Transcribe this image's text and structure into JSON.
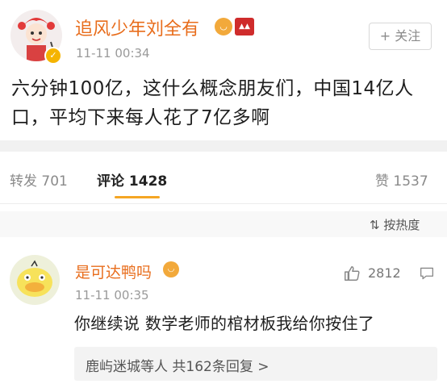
{
  "post": {
    "username": "追风少年刘全有",
    "time": "11-11 00:34",
    "follow_label": "+ 关注",
    "content": "六分钟100亿，这什么概念朋友们，中国14亿人口，平均下来每人花了7亿多啊",
    "icons": [
      "avatar-icon",
      "verified-icon",
      "emoji-badge-icon",
      "cat-badge-icon"
    ]
  },
  "tabs": {
    "repost": "转发 701",
    "comment": "评论 1428",
    "like": "赞 1537"
  },
  "sort_label": "按热度",
  "comment": {
    "username": "是可达鸭吗",
    "time": "11-11 00:35",
    "like_count": "2812",
    "text": "你继续说 数学老师的棺材板我给你按住了",
    "reply_summary": "鹿屿迷城等人  共162条回复 >"
  },
  "colors": {
    "username": "#e86d1c",
    "accent": "#f5a623"
  }
}
